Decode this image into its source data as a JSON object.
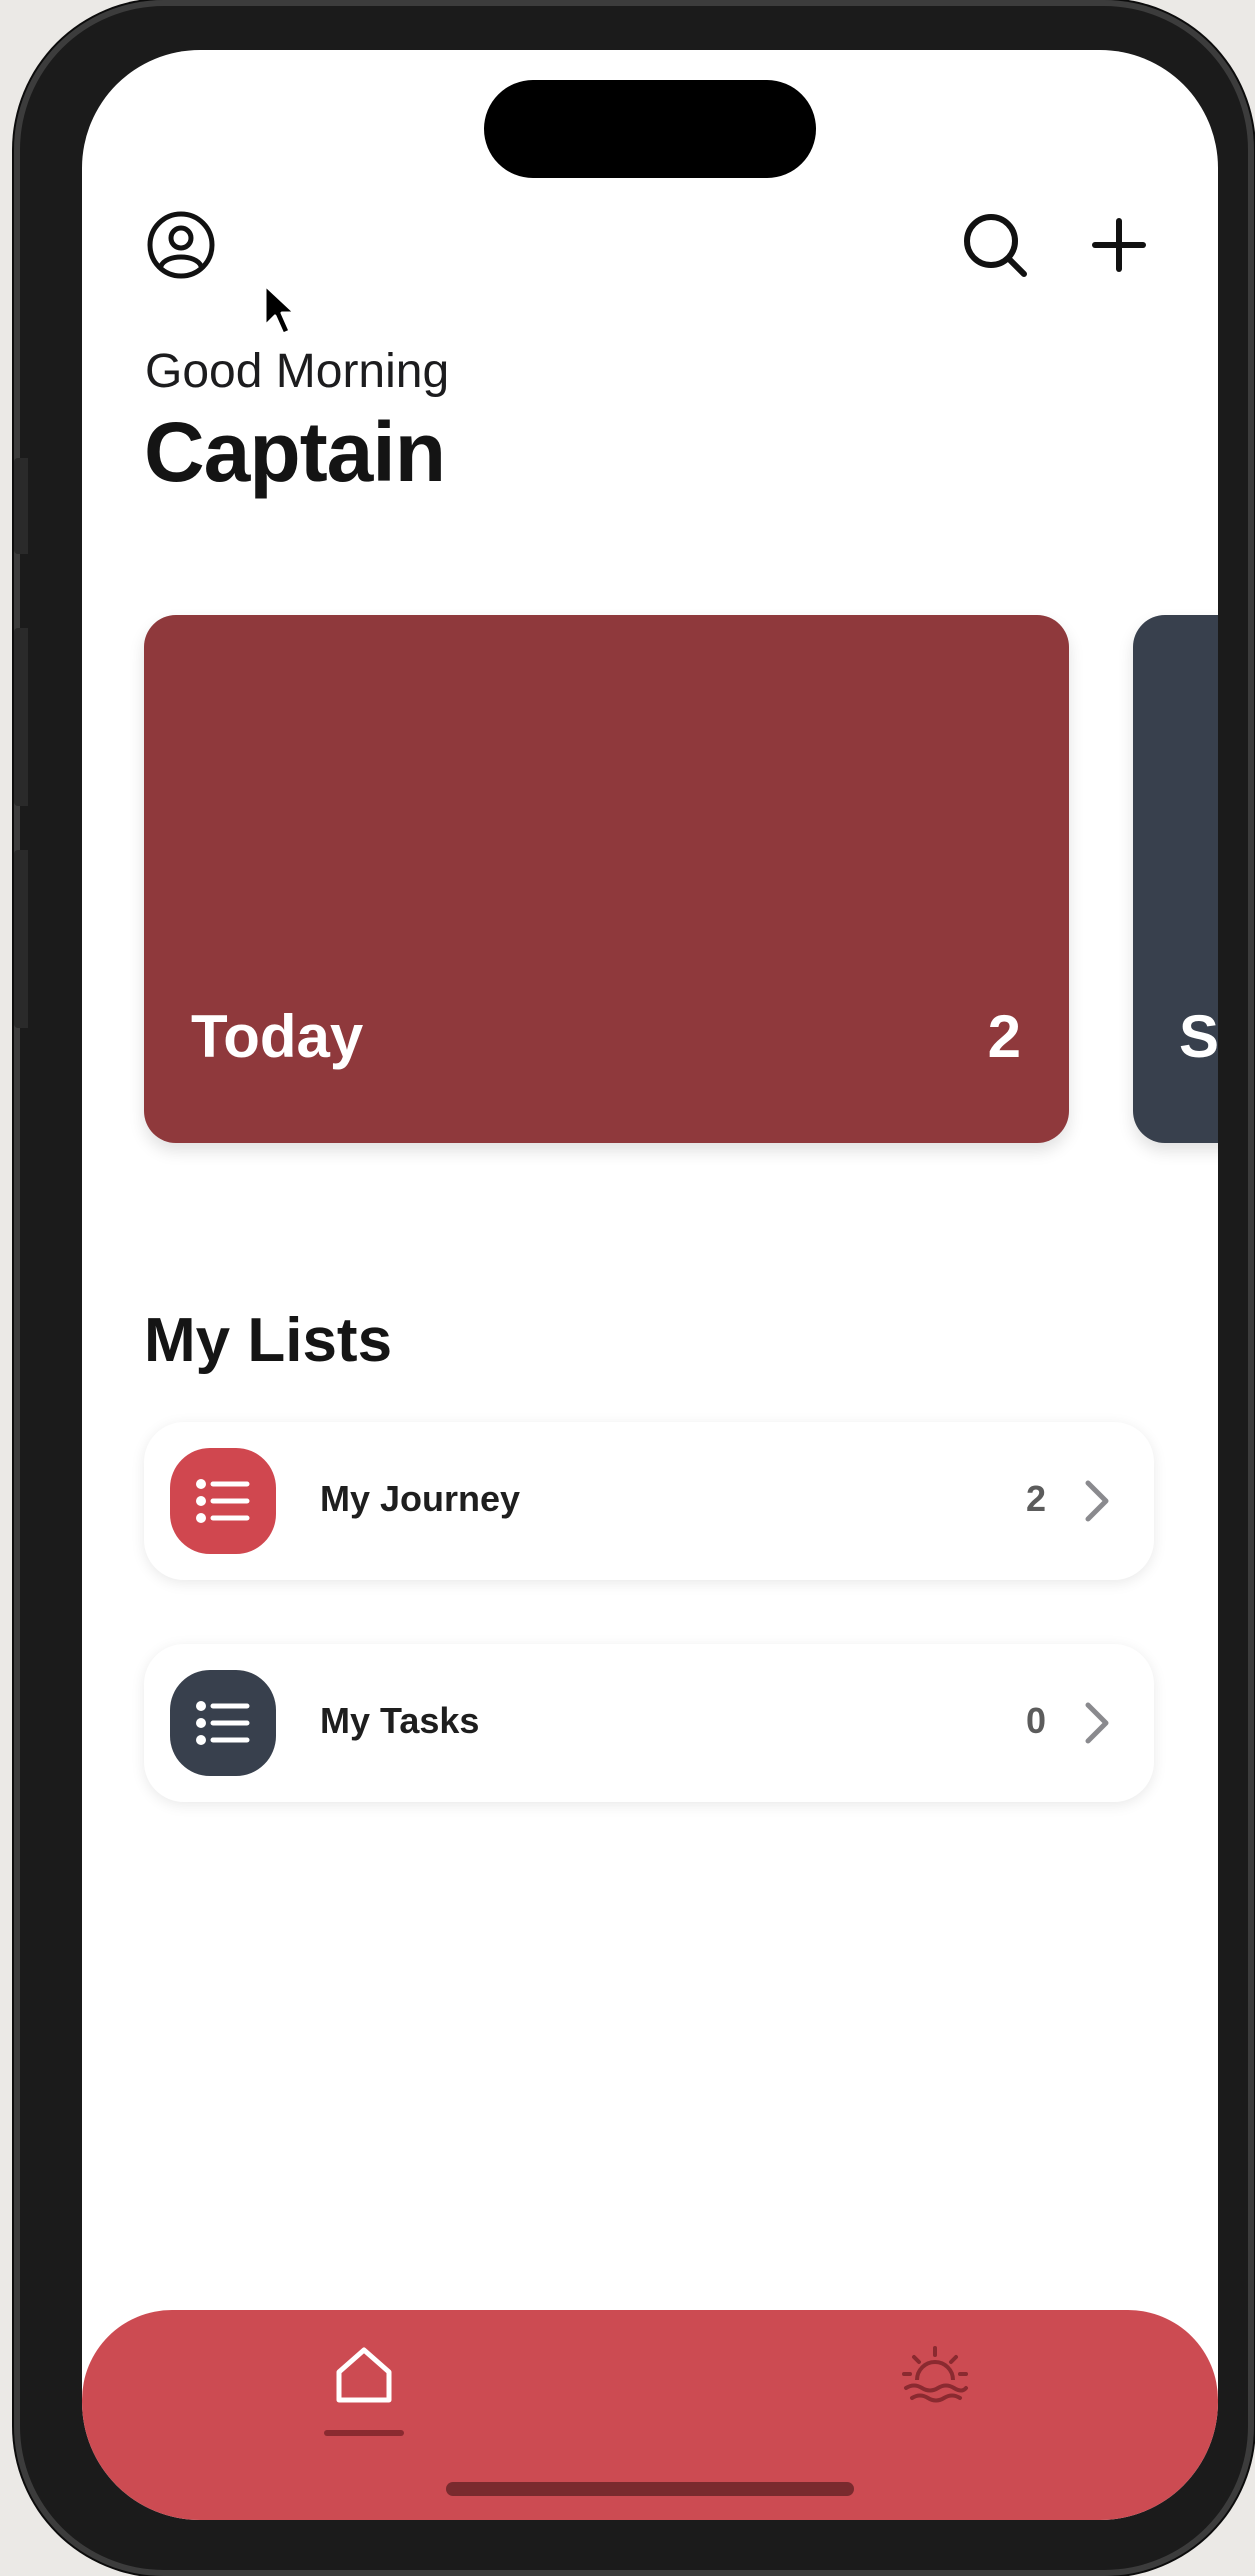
{
  "header": {
    "greeting": "Good Morning",
    "name": "Captain"
  },
  "cards": [
    {
      "title": "Today",
      "count": "2",
      "color": "#8f393c"
    },
    {
      "title": "S",
      "count": "",
      "color": "#38404d"
    }
  ],
  "my_lists": {
    "title": "My Lists",
    "items": [
      {
        "label": "My Journey",
        "count": "2",
        "icon": "list-icon",
        "color": "#d0474f"
      },
      {
        "label": "My Tasks",
        "count": "0",
        "icon": "list-icon",
        "color": "#38404d"
      }
    ]
  },
  "tabs": [
    {
      "icon": "home-icon",
      "selected": true
    },
    {
      "icon": "sunrise-icon",
      "selected": false
    }
  ],
  "colors": {
    "accent": "#cc4b52",
    "dark": "#38404d"
  }
}
